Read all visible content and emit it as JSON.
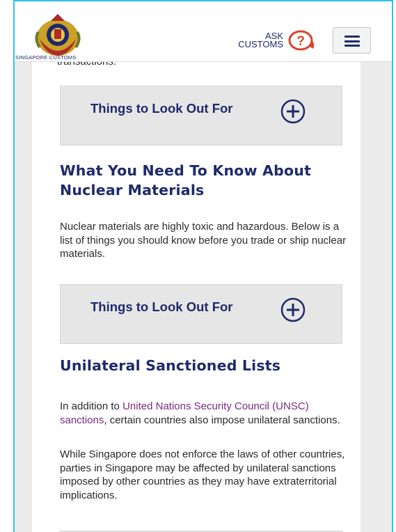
{
  "header": {
    "logo_text": "SINGAPORE CUSTOMS",
    "ask_line1": "ASK",
    "ask_line2": "CUSTOMS",
    "help_icon": "help-question-icon",
    "menu_icon": "hamburger-menu-icon"
  },
  "cutoff_text": "transactions.",
  "sections": [
    {
      "accordion_label": "Things to Look Out For"
    },
    {
      "heading": "What You Need To Know About Nuclear Materials",
      "body": "Nuclear materials are highly toxic and hazardous. Below is a list of things you should know before you trade or ship nuclear materials.",
      "accordion_label": "Things to Look Out For"
    },
    {
      "heading": "Unilateral Sanctioned Lists",
      "body1_prefix": "In addition to ",
      "body1_link": "United Nations Security Council (UNSC) sanctions",
      "body1_suffix": ", certain countries also impose unilateral sanctions.",
      "body2": "While Singapore does not enforce the laws of other countries, parties in Singapore may be affected by unilateral sanctions imposed by other countries as they may have extraterritorial implications."
    }
  ],
  "colors": {
    "frame": "#2bc3f0",
    "brand_navy": "#1e2a6b",
    "link_purple": "#7a2a80",
    "help_red": "#d9442b"
  }
}
